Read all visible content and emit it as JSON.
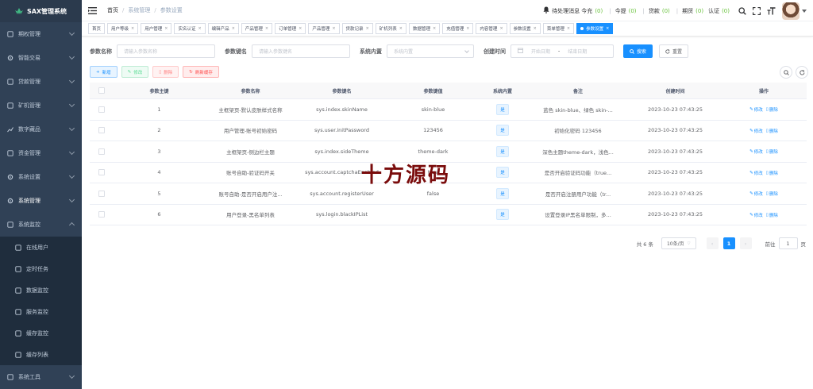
{
  "app": {
    "title": "SAX管理系统"
  },
  "sidebar": {
    "items": [
      {
        "label": "期权管理",
        "icon": "options-icon"
      },
      {
        "label": "智能交易",
        "icon": "gear-cog-icon"
      },
      {
        "label": "贷款管理",
        "icon": "loan-icon"
      },
      {
        "label": "矿机管理",
        "icon": "miner-icon"
      },
      {
        "label": "数字藏品",
        "icon": "chart-icon"
      },
      {
        "label": "资金管理",
        "icon": "fund-icon"
      },
      {
        "label": "系统设置",
        "icon": "settings-icon"
      },
      {
        "label": "系统管理",
        "icon": "system-icon"
      },
      {
        "label": "系统监控",
        "icon": "monitor-icon"
      }
    ],
    "submenu": [
      {
        "label": "在线用户",
        "icon": "online-icon"
      },
      {
        "label": "定时任务",
        "icon": "job-icon"
      },
      {
        "label": "数据监控",
        "icon": "data-icon"
      },
      {
        "label": "服务监控",
        "icon": "server-icon"
      },
      {
        "label": "缓存监控",
        "icon": "cache-icon"
      },
      {
        "label": "缓存列表",
        "icon": "cache-list-icon"
      }
    ],
    "bottom_item": {
      "label": "系统工具"
    }
  },
  "header": {
    "breadcrumb": [
      "首页",
      "系统管理",
      "参数设置"
    ],
    "notice_label": "待处理消息 今充",
    "notice_count": "(0)",
    "withdraw_label": "今提",
    "withdraw_count": "(0)",
    "loan_label": "贷款",
    "loan_count": "(0)",
    "option_label": "期货",
    "option_count": "(0)",
    "auth_label": "认证",
    "auth_count": "(0)"
  },
  "tags": [
    {
      "label": "首页",
      "closable": false
    },
    {
      "label": "用户等级",
      "closable": true
    },
    {
      "label": "用户管理",
      "closable": true
    },
    {
      "label": "实名认证",
      "closable": true
    },
    {
      "label": "编辑产品",
      "closable": true
    },
    {
      "label": "产品管理",
      "closable": true
    },
    {
      "label": "订单管理",
      "closable": true
    },
    {
      "label": "产品管理",
      "closable": true
    },
    {
      "label": "贷款记录",
      "closable": true
    },
    {
      "label": "矿机列表",
      "closable": true
    },
    {
      "label": "数据管理",
      "closable": true
    },
    {
      "label": "充值管理",
      "closable": true
    },
    {
      "label": "内容管理",
      "closable": true
    },
    {
      "label": "参数设置",
      "closable": true
    },
    {
      "label": "菜单管理",
      "closable": true
    },
    {
      "label": "参数设置",
      "closable": true,
      "active": true
    }
  ],
  "search": {
    "name_label": "参数名称",
    "name_placeholder": "请输入参数名称",
    "key_label": "参数键名",
    "key_placeholder": "请输入参数键名",
    "sys_label": "系统内置",
    "sys_placeholder": "系统内置",
    "time_label": "创建时间",
    "start_placeholder": "开始日期",
    "date_sep": "-",
    "end_placeholder": "结束日期",
    "search_btn": "搜索",
    "reset_btn": "重置"
  },
  "toolbar": {
    "add": "新增",
    "edit": "修改",
    "delete": "删除",
    "refresh": "刷新缓存"
  },
  "table": {
    "columns": [
      "参数主键",
      "参数名称",
      "参数键名",
      "参数键值",
      "系统内置",
      "备注",
      "创建时间",
      "操作"
    ],
    "rows": [
      {
        "id": "1",
        "name": "主框架页-默认皮肤样式名称",
        "key": "sys.index.skinName",
        "value": "skin-blue",
        "sys": "是",
        "remark": "蓝色 skin-blue、绿色 skin-...",
        "time": "2023-10-23 07:43:25"
      },
      {
        "id": "2",
        "name": "用户管理-账号初始密码",
        "key": "sys.user.initPassword",
        "value": "123456",
        "sys": "是",
        "remark": "初始化密码 123456",
        "time": "2023-10-23 07:43:25"
      },
      {
        "id": "3",
        "name": "主框架页-侧边栏主题",
        "key": "sys.index.sideTheme",
        "value": "theme-dark",
        "sys": "是",
        "remark": "深色主题theme-dark，浅色...",
        "time": "2023-10-23 07:43:25"
      },
      {
        "id": "4",
        "name": "账号自助-验证码开关",
        "key": "sys.account.captchaEnabled",
        "value": "true",
        "sys": "是",
        "remark": "是否开启验证码功能（true...",
        "time": "2023-10-23 07:43:25"
      },
      {
        "id": "5",
        "name": "账号自助-是否开启用户注...",
        "key": "sys.account.registerUser",
        "value": "false",
        "sys": "是",
        "remark": "是否开启注册用户功能（tr...",
        "time": "2023-10-23 07:43:25"
      },
      {
        "id": "6",
        "name": "用户登录-黑名单列表",
        "key": "sys.login.blackIPList",
        "value": "",
        "sys": "是",
        "remark": "设置登录IP黑名单限制，多...",
        "time": "2023-10-23 07:43:25"
      }
    ],
    "op_edit": "修改",
    "op_delete": "删除"
  },
  "pagination": {
    "total": "共 6 条",
    "page_size": "10条/页",
    "current": "1",
    "goto_label": "前往",
    "goto_value": "1",
    "page_unit": "页"
  },
  "watermark": "十方源码",
  "colors": {
    "primary": "#1890ff",
    "sidebar": "#304156",
    "success": "#13ce66",
    "danger": "#ff4949"
  }
}
